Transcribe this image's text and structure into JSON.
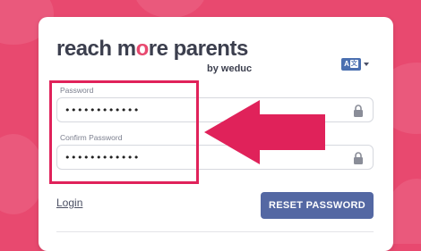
{
  "logo": {
    "text_part1": "reach m",
    "text_highlight": "o",
    "text_part2": "re parents",
    "subtext": "by weduc",
    "accent_color": "#e8496f"
  },
  "language": {
    "icon": "translate-icon",
    "badge_a": "A",
    "badge_b": "文"
  },
  "password": {
    "label": "Password",
    "value": "••••••••••••"
  },
  "confirm_password": {
    "label": "Confirm Password",
    "value": "••••••••••••"
  },
  "login_link": "Login",
  "reset_button": "RESET PASSWORD",
  "colors": {
    "background": "#e8496f",
    "button": "#5468a3",
    "highlight": "#e0225a"
  }
}
